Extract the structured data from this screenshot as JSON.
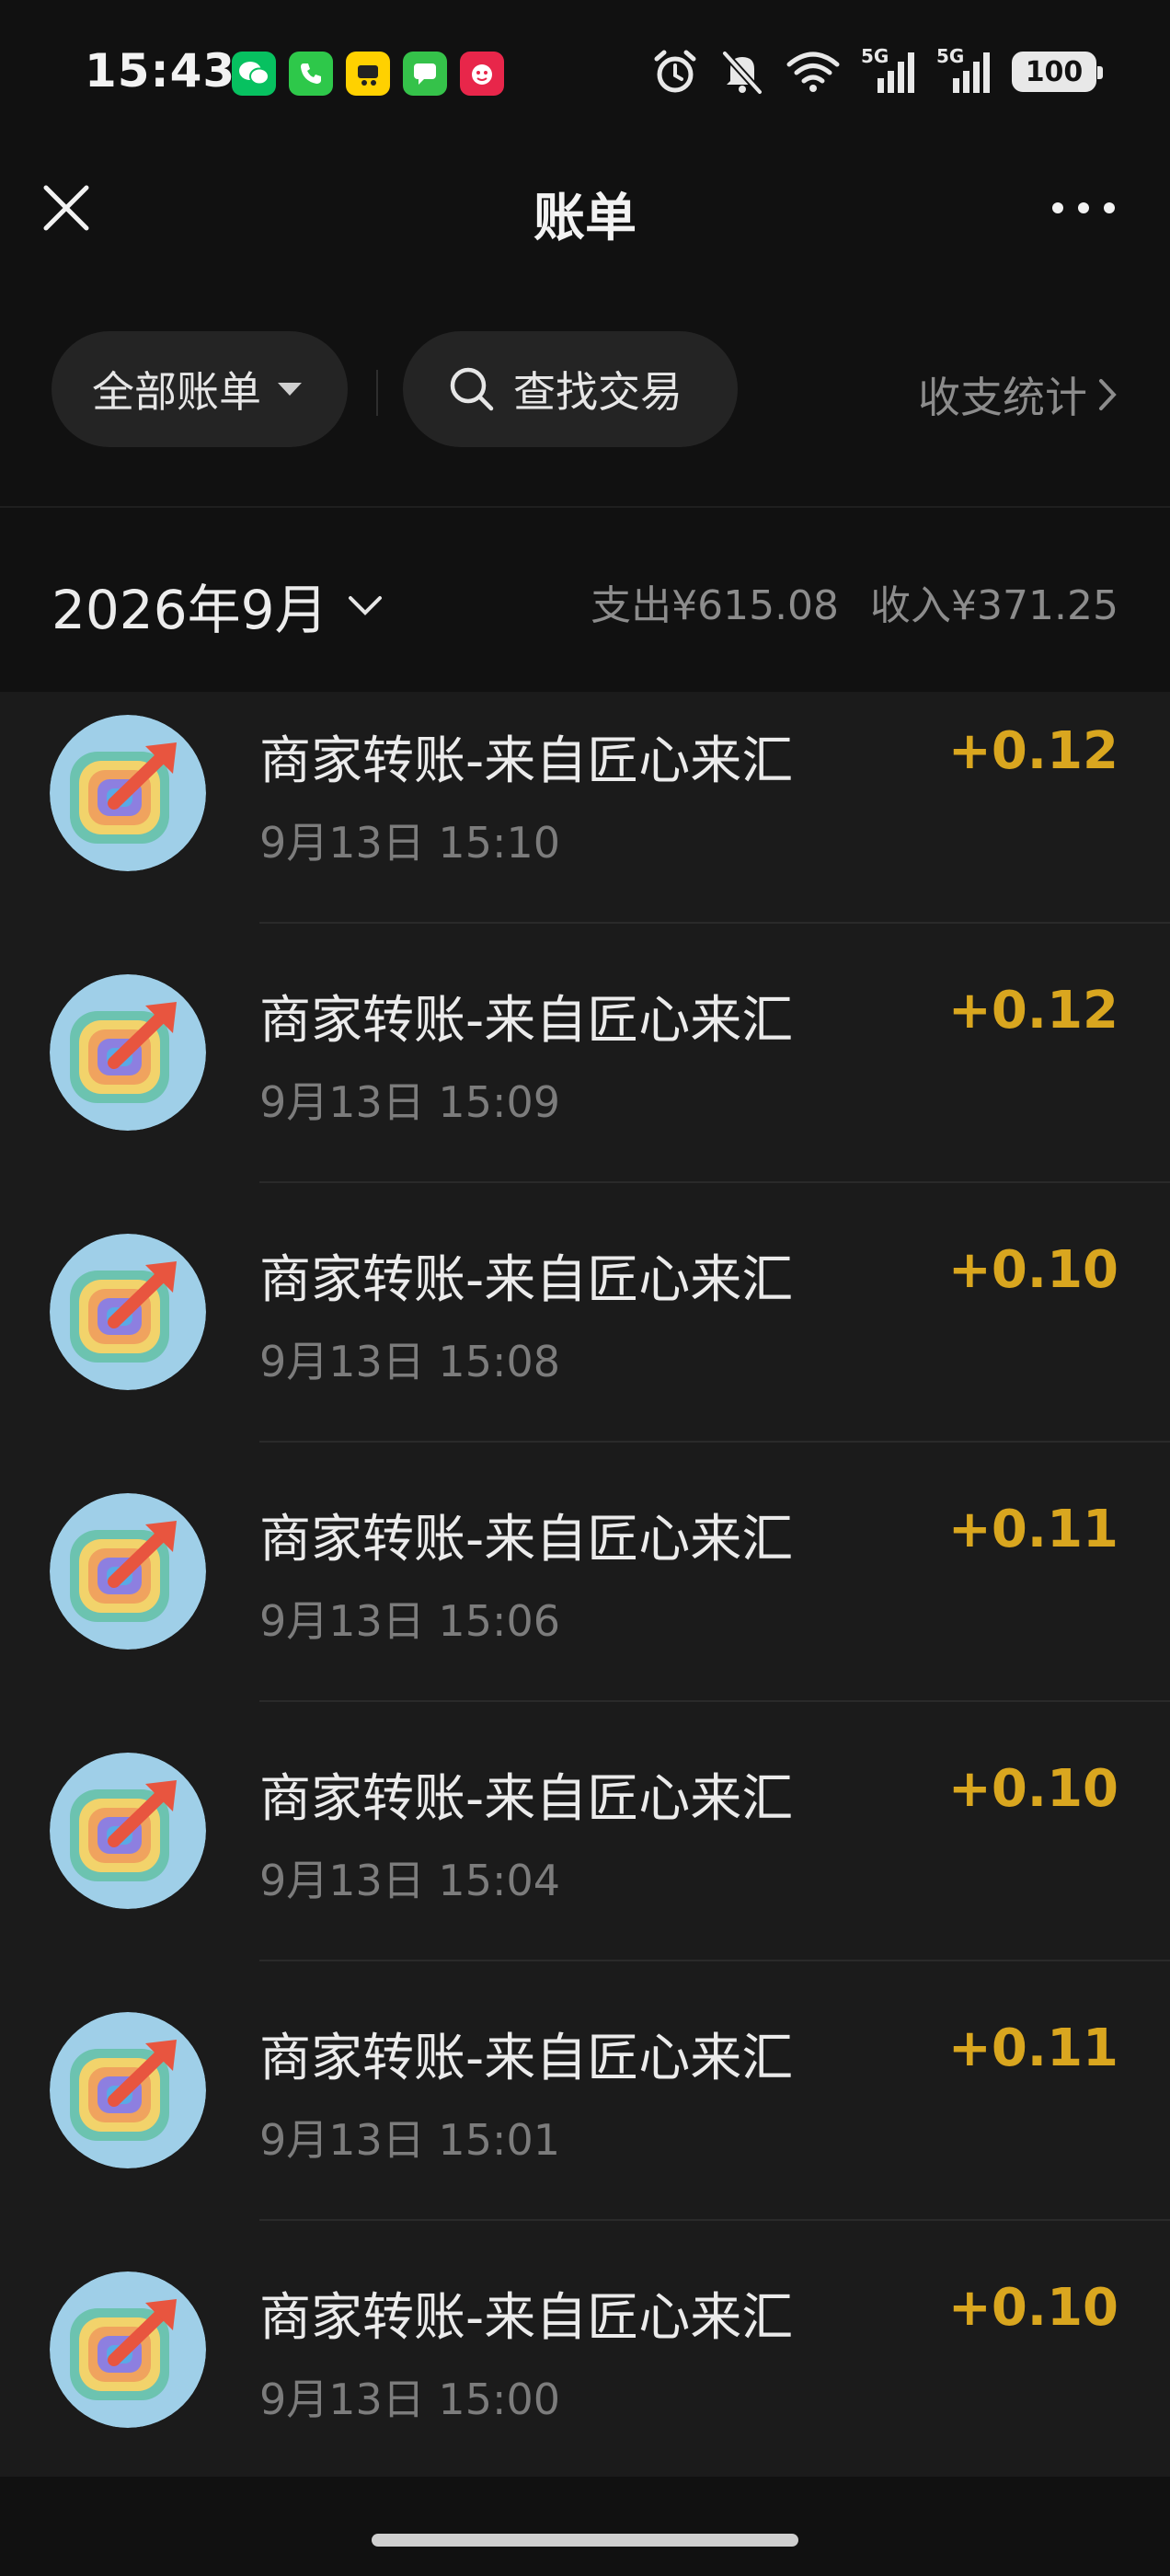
{
  "status_bar": {
    "time": "15:43",
    "notification_icons": [
      "wechat-icon",
      "phone-icon",
      "meituan-icon",
      "messages-icon",
      "pinduoduo-icon"
    ],
    "right_icons": [
      "alarm-icon",
      "mute-bell-icon",
      "wifi-icon",
      "signal-5g-icon",
      "signal-5g-icon"
    ],
    "signal_label_1": "5G",
    "signal_label_2": "5G",
    "battery": "100"
  },
  "nav": {
    "title": "账单"
  },
  "filters": {
    "all_bills_label": "全部账单",
    "search_label": "查找交易",
    "stats_label": "收支统计"
  },
  "month": {
    "label": "2026年9月",
    "expense": "支出¥615.08",
    "income": "收入¥371.25"
  },
  "transactions": [
    {
      "title": "商家转账-来自匠心来汇",
      "time": "9月13日 15:10",
      "amount": "+0.12"
    },
    {
      "title": "商家转账-来自匠心来汇",
      "time": "9月13日 15:09",
      "amount": "+0.12"
    },
    {
      "title": "商家转账-来自匠心来汇",
      "time": "9月13日 15:08",
      "amount": "+0.10"
    },
    {
      "title": "商家转账-来自匠心来汇",
      "time": "9月13日 15:06",
      "amount": "+0.11"
    },
    {
      "title": "商家转账-来自匠心来汇",
      "time": "9月13日 15:04",
      "amount": "+0.10"
    },
    {
      "title": "商家转账-来自匠心来汇",
      "time": "9月13日 15:01",
      "amount": "+0.11"
    },
    {
      "title": "商家转账-来自匠心来汇",
      "time": "9月13日 15:00",
      "amount": "+0.10"
    }
  ],
  "colors": {
    "background": "#111111",
    "list_background": "#1b1b1b",
    "amount_income": "#d9a61f",
    "wechat_green": "#07c160"
  }
}
